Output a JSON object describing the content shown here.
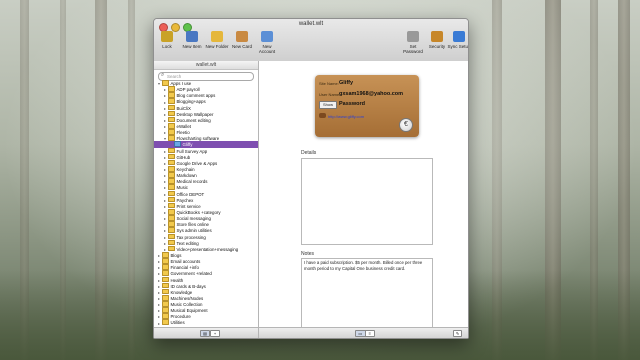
{
  "window": {
    "title": "wallet.wlt",
    "sidebar_header": "wallet.wlt"
  },
  "toolbar": {
    "items": [
      {
        "label": "Lock",
        "icon": "lock-icon",
        "color": "#c9a227"
      },
      {
        "label": "New Item",
        "icon": "new-item-icon",
        "color": "#4a78c2"
      },
      {
        "label": "New Folder",
        "icon": "folder-icon",
        "color": "#e5b73b"
      },
      {
        "label": "New Card",
        "icon": "card-icon",
        "color": "#c98a42"
      },
      {
        "label": "New Account",
        "icon": "account-icon",
        "color": "#5b8fd6"
      },
      {
        "label": "Set Password",
        "icon": "password-icon",
        "color": "#999999"
      },
      {
        "label": "Security",
        "icon": "security-icon",
        "color": "#c7872a"
      },
      {
        "label": "Sync Setup",
        "icon": "sync-icon",
        "color": "#3a7bd5"
      }
    ]
  },
  "search": {
    "placeholder": "Search"
  },
  "tree": [
    {
      "label": "Apps I use",
      "level": 0,
      "expanded": true
    },
    {
      "label": "ADP payroll",
      "level": 1
    },
    {
      "label": "Blog comment apps",
      "level": 1
    },
    {
      "label": "Blogging+apps",
      "level": 1
    },
    {
      "label": "BuiCliX",
      "level": 1
    },
    {
      "label": "Desktop Wallpaper",
      "level": 1
    },
    {
      "label": "Document editing",
      "level": 1
    },
    {
      "label": "eWallet",
      "level": 1
    },
    {
      "label": "Fleetio",
      "level": 1
    },
    {
      "label": "Flowcharting software",
      "level": 1,
      "expanded": true
    },
    {
      "label": "Gliffy",
      "level": 2,
      "selected": true
    },
    {
      "label": "Full Survey App",
      "level": 1
    },
    {
      "label": "GitHub",
      "level": 1
    },
    {
      "label": "Google Drive & Apps",
      "level": 1
    },
    {
      "label": "Keychain",
      "level": 1
    },
    {
      "label": "Markdown",
      "level": 1
    },
    {
      "label": "Medical records",
      "level": 1
    },
    {
      "label": "Music",
      "level": 1
    },
    {
      "label": "Office DEPOT",
      "level": 1
    },
    {
      "label": "Paychex",
      "level": 1
    },
    {
      "label": "Print service",
      "level": 1
    },
    {
      "label": "QuickBooks +category",
      "level": 1
    },
    {
      "label": "Social messaging",
      "level": 1
    },
    {
      "label": "Store files online",
      "level": 1
    },
    {
      "label": "Sys admin utilities",
      "level": 1
    },
    {
      "label": "Tax processing",
      "level": 1
    },
    {
      "label": "Text editing",
      "level": 1
    },
    {
      "label": "Video+presentation+messaging",
      "level": 1
    },
    {
      "label": "Blogs",
      "level": 0
    },
    {
      "label": "Email accounts",
      "level": 0
    },
    {
      "label": "Financial +info",
      "level": 0
    },
    {
      "label": "Government +related",
      "level": 0
    },
    {
      "label": "Health",
      "level": 0
    },
    {
      "label": "ID cards & B-days",
      "level": 0
    },
    {
      "label": "Knowledge",
      "level": 0
    },
    {
      "label": "Machines/Nodes",
      "level": 0
    },
    {
      "label": "Music Collection",
      "level": 0
    },
    {
      "label": "Musical Equipment",
      "level": 0
    },
    {
      "label": "Procedure",
      "level": 0
    },
    {
      "label": "Utilities",
      "level": 0
    }
  ],
  "card": {
    "site_name_label": "Site Name:",
    "site_name": "Gliffy",
    "user_name_label": "User Name:",
    "user_name": "gxsam1968@yahoo.com",
    "show_button": "Show",
    "password_label": "Password",
    "url": "http://www.gliffy.com",
    "coin_symbol": "€"
  },
  "details": {
    "label": "Details",
    "text": ""
  },
  "notes": {
    "label": "Notes",
    "text": "I have a paid subscription. $5 per month. Billed once per three month period to my Capital One business credit card."
  },
  "colors": {
    "selection": "#7e4fb0",
    "card": "#b27a3e"
  }
}
